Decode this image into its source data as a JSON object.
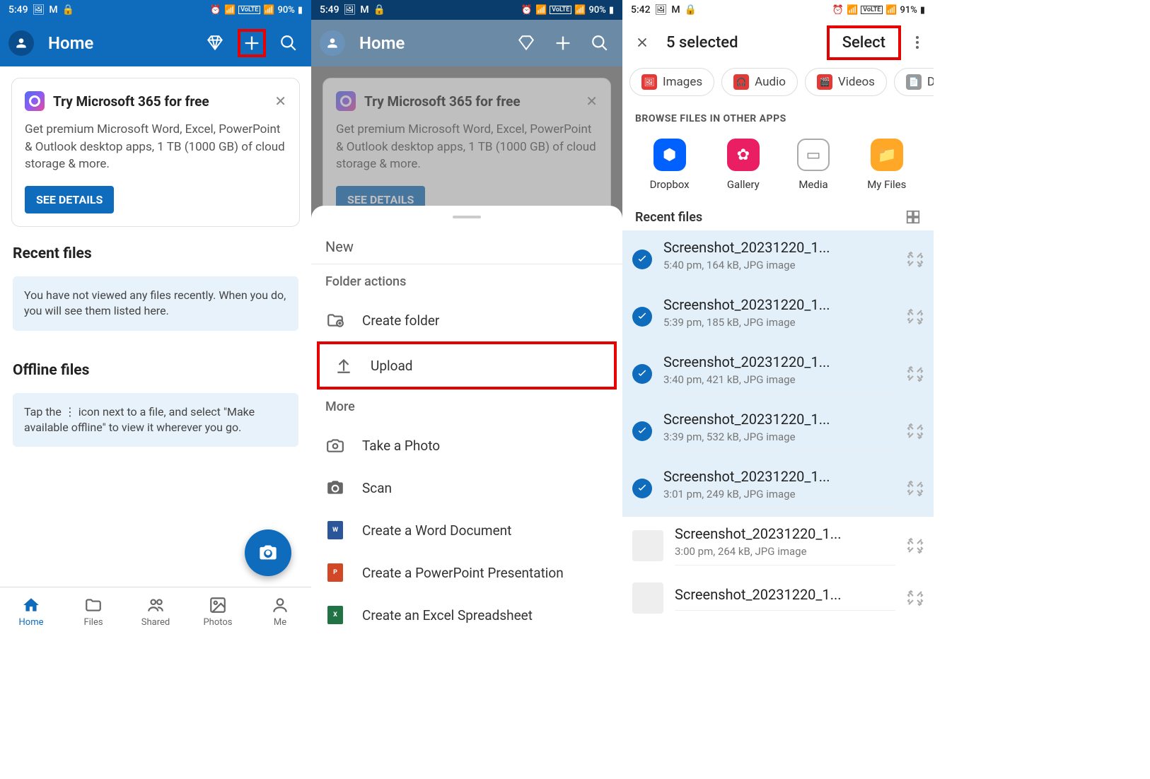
{
  "screen1": {
    "status": {
      "time": "5:49",
      "battery": "90%"
    },
    "title": "Home",
    "card": {
      "title": "Try Microsoft 365 for free",
      "desc": "Get premium Microsoft Word, Excel, PowerPoint & Outlook desktop apps, 1 TB (1000 GB) of cloud storage & more.",
      "button": "SEE DETAILS"
    },
    "recent_title": "Recent files",
    "recent_info": "You have not viewed any files recently. When you do, you will see them listed here.",
    "offline_title": "Offline files",
    "offline_info": "Tap the  ⋮  icon next to a file, and select \"Make available offline\" to view it wherever you go.",
    "nav": [
      {
        "label": "Home"
      },
      {
        "label": "Files"
      },
      {
        "label": "Shared"
      },
      {
        "label": "Photos"
      },
      {
        "label": "Me"
      }
    ]
  },
  "screen2": {
    "status": {
      "time": "5:49",
      "battery": "90%"
    },
    "title": "Home",
    "card": {
      "title": "Try Microsoft 365 for free",
      "desc": "Get premium Microsoft Word, Excel, PowerPoint & Outlook desktop apps, 1 TB (1000 GB) of cloud storage & more.",
      "button": "SEE DETAILS"
    },
    "sheet": {
      "new": "New",
      "folder_actions": "Folder actions",
      "create_folder": "Create folder",
      "upload": "Upload",
      "more": "More",
      "take_photo": "Take a Photo",
      "scan": "Scan",
      "word": "Create a Word Document",
      "ppt": "Create a PowerPoint Presentation",
      "excel": "Create an Excel Spreadsheet"
    }
  },
  "screen3": {
    "status": {
      "time": "5:42",
      "battery": "91%"
    },
    "selected": "5 selected",
    "select": "Select",
    "chips": [
      {
        "label": "Images"
      },
      {
        "label": "Audio"
      },
      {
        "label": "Videos"
      },
      {
        "label": "Do"
      }
    ],
    "browse": "BROWSE FILES IN OTHER APPS",
    "apps": [
      {
        "label": "Dropbox"
      },
      {
        "label": "Gallery"
      },
      {
        "label": "Media"
      },
      {
        "label": "My Files"
      }
    ],
    "recent": "Recent files",
    "files": [
      {
        "name": "Screenshot_20231220_1...",
        "meta": "5:40 pm, 164 kB, JPG image",
        "sel": true
      },
      {
        "name": "Screenshot_20231220_1...",
        "meta": "5:39 pm, 185 kB, JPG image",
        "sel": true
      },
      {
        "name": "Screenshot_20231220_1...",
        "meta": "3:40 pm, 421 kB, JPG image",
        "sel": true
      },
      {
        "name": "Screenshot_20231220_1...",
        "meta": "3:39 pm, 532 kB, JPG image",
        "sel": true
      },
      {
        "name": "Screenshot_20231220_1...",
        "meta": "3:01 pm, 249 kB, JPG image",
        "sel": true
      },
      {
        "name": "Screenshot_20231220_1...",
        "meta": "3:00 pm, 264 kB, JPG image",
        "sel": false
      },
      {
        "name": "Screenshot_20231220_1...",
        "meta": "",
        "sel": false
      }
    ]
  }
}
